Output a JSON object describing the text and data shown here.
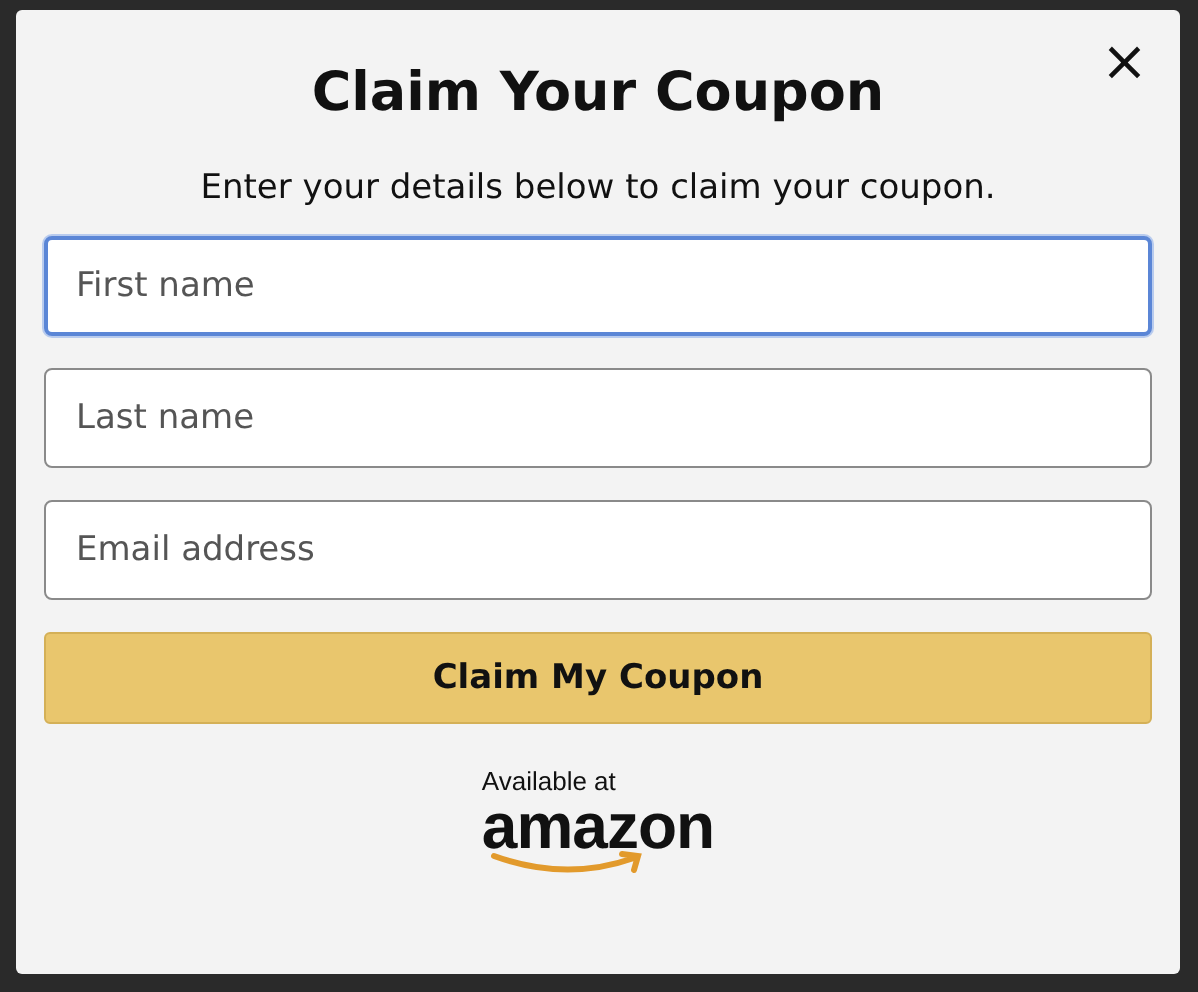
{
  "dialog": {
    "close": "×",
    "title": "Claim Your Coupon",
    "subtitle": "Enter your details below to claim your coupon.",
    "fields": [
      {
        "placeholder": "First name",
        "focused": true
      },
      {
        "placeholder": "Last name",
        "focused": false
      },
      {
        "placeholder": "Email address",
        "focused": false
      }
    ],
    "button": "Claim My Coupon",
    "badge": {
      "caption": "Available at",
      "brand": "amazon"
    }
  }
}
